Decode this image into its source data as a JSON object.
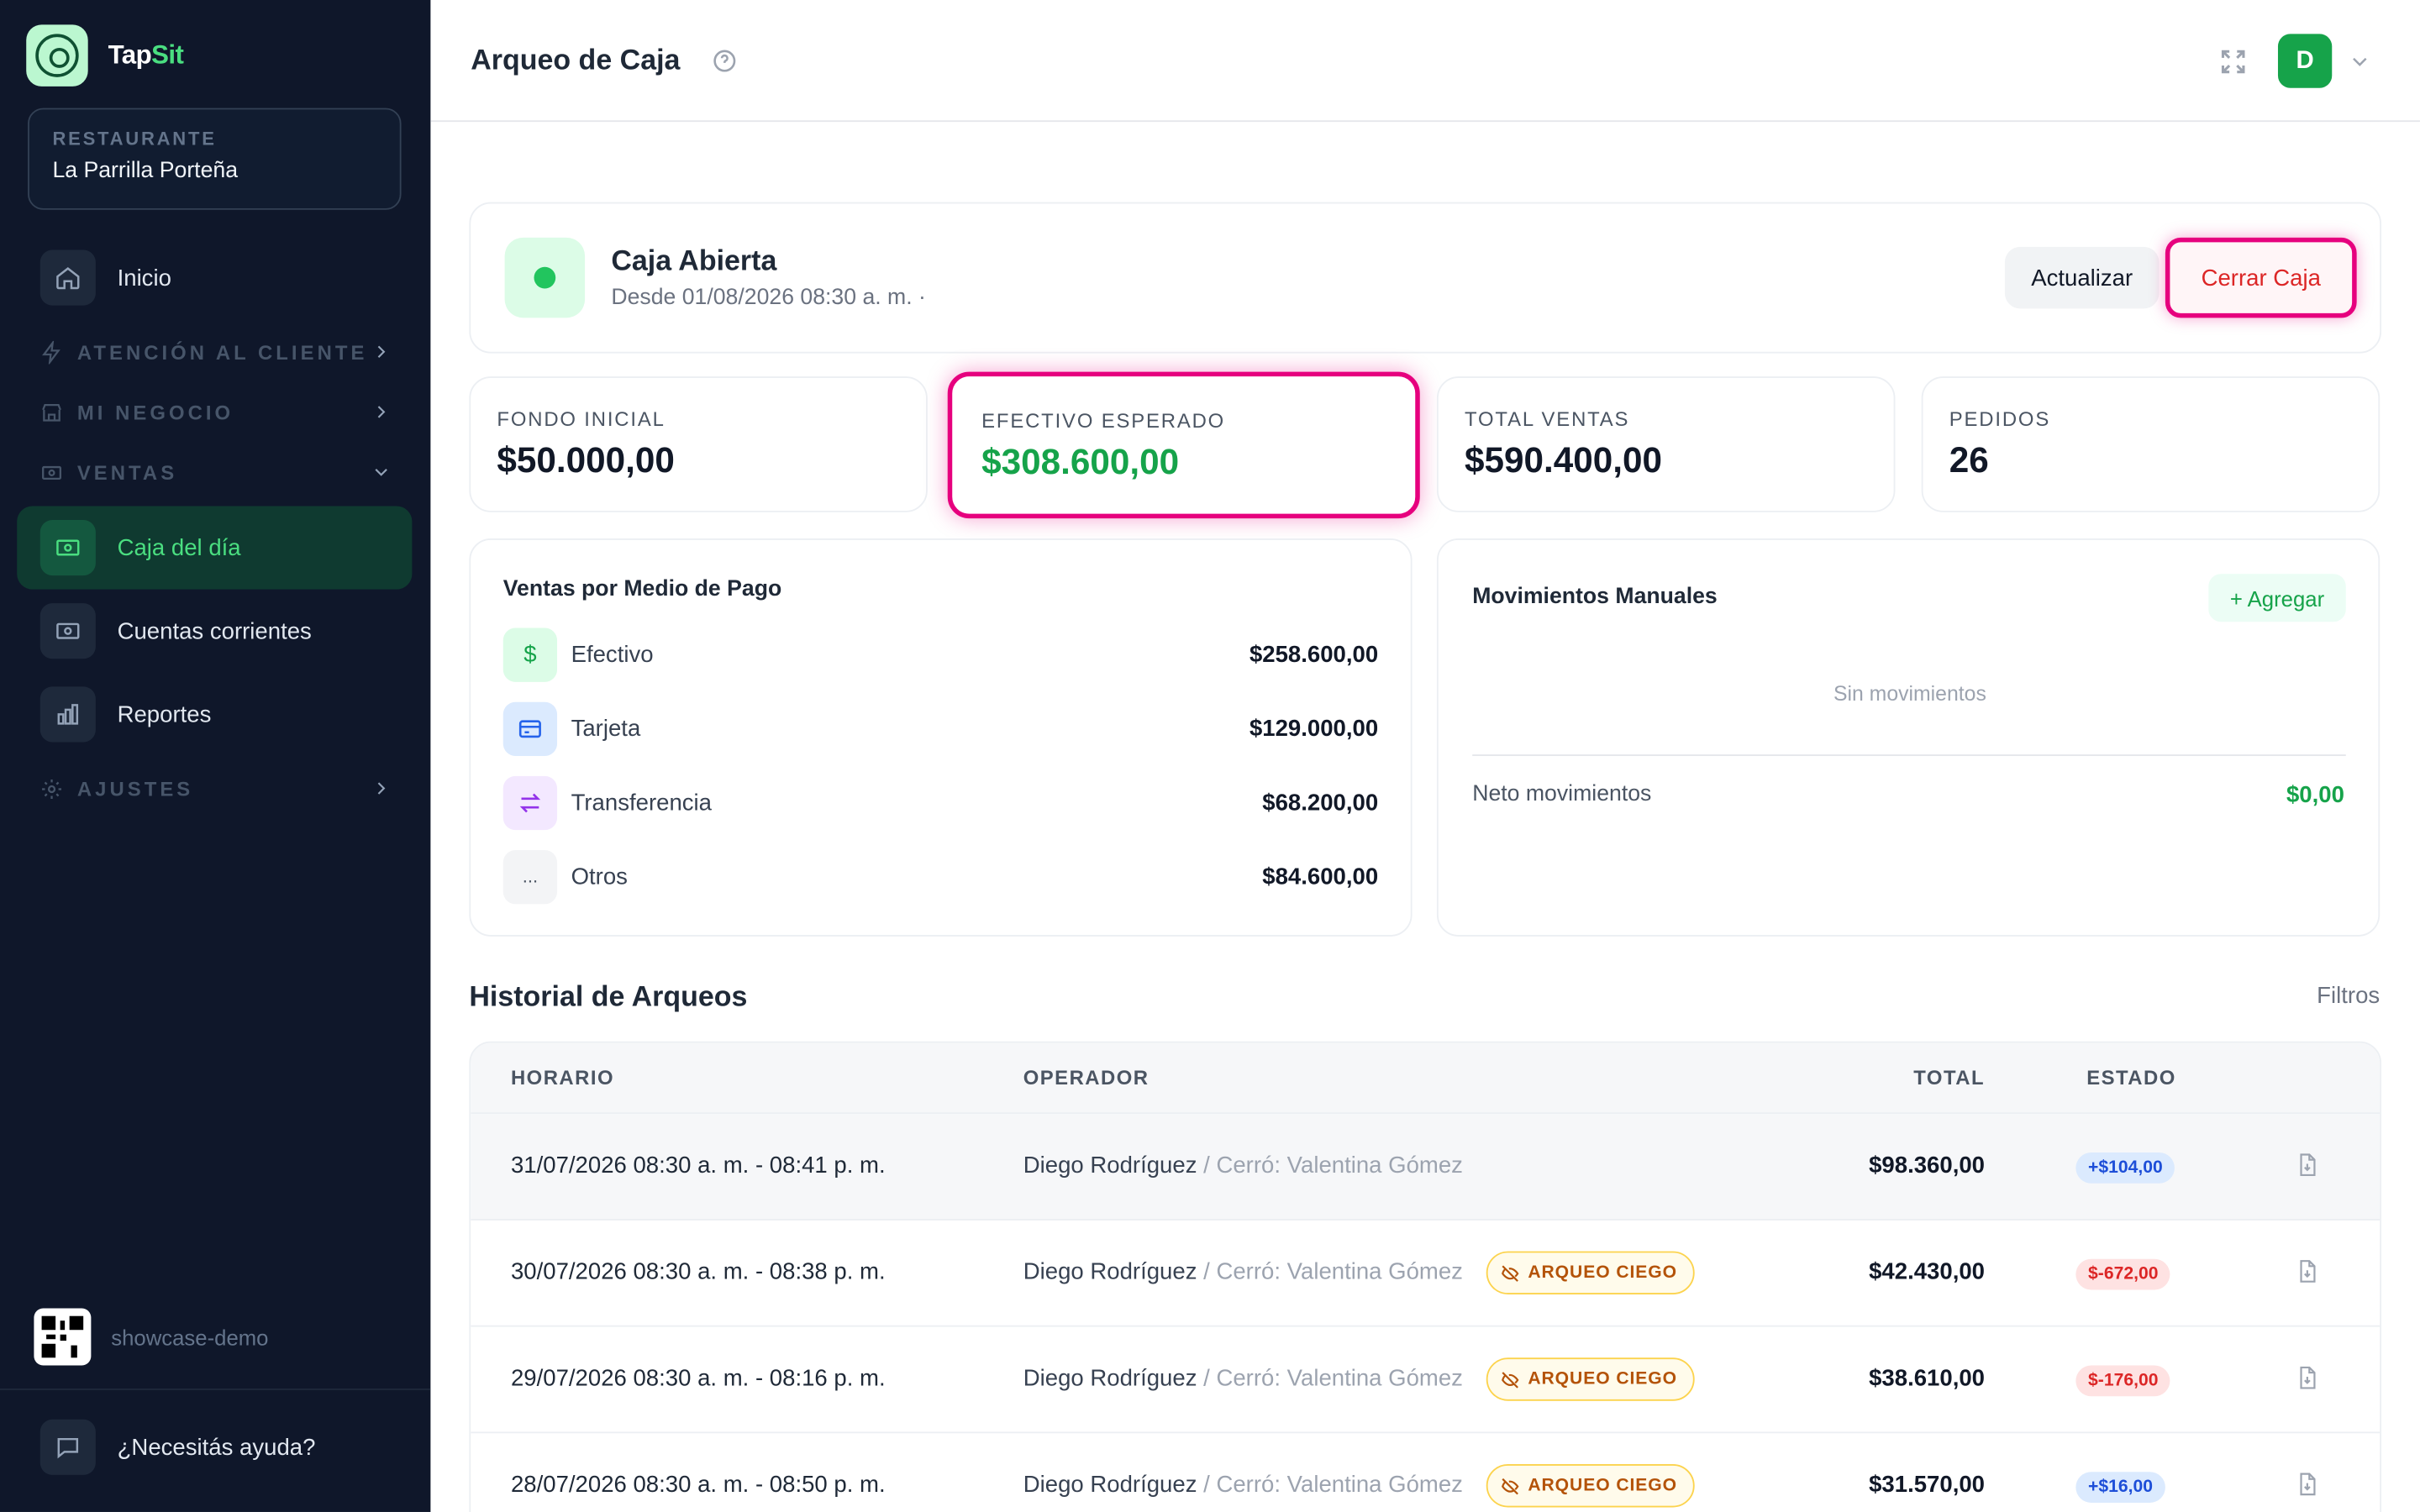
{
  "brand": {
    "name_main": "Tap",
    "name_accent": "Sit"
  },
  "restaurant": {
    "label": "RESTAURANTE",
    "name": "La Parrilla Porteña"
  },
  "nav": {
    "inicio": "Inicio",
    "atencion": "ATENCIÓN AL CLIENTE",
    "negocio": "MI NEGOCIO",
    "ventas": "VENTAS",
    "caja": "Caja del día",
    "cuentas": "Cuentas corrientes",
    "reportes": "Reportes",
    "ajustes": "AJUSTES"
  },
  "footer": {
    "workspace": "showcase-demo",
    "help": "¿Necesitás ayuda?"
  },
  "header": {
    "title": "Arqueo de Caja",
    "avatar_initial": "D"
  },
  "status": {
    "title": "Caja Abierta",
    "subtitle": "Desde 01/08/2026 08:30 a. m. ·",
    "refresh_label": "Actualizar",
    "close_label": "Cerrar Caja"
  },
  "stats": [
    {
      "label": "FONDO INICIAL",
      "value": "$50.000,00"
    },
    {
      "label": "EFECTIVO ESPERADO",
      "value": "$308.600,00"
    },
    {
      "label": "TOTAL VENTAS",
      "value": "$590.400,00"
    },
    {
      "label": "PEDIDOS",
      "value": "26"
    }
  ],
  "payments": {
    "title": "Ventas por Medio de Pago",
    "rows": [
      {
        "name": "Efectivo",
        "amount": "$258.600,00",
        "icon": "dollar-icon",
        "glyph": "$"
      },
      {
        "name": "Tarjeta",
        "amount": "$129.000,00",
        "icon": "credit-card-icon",
        "glyph": ""
      },
      {
        "name": "Transferencia",
        "amount": "$68.200,00",
        "icon": "transfer-arrows-icon",
        "glyph": ""
      },
      {
        "name": "Otros",
        "amount": "$84.600,00",
        "icon": "ellipsis-icon",
        "glyph": "..."
      }
    ]
  },
  "movements": {
    "title": "Movimientos Manuales",
    "add_label": "+ Agregar",
    "empty": "Sin movimientos",
    "net_label": "Neto movimientos",
    "net_value": "$0,00"
  },
  "history": {
    "title": "Historial de Arqueos",
    "filters_label": "Filtros",
    "columns": {
      "time": "HORARIO",
      "operator": "OPERADOR",
      "total": "TOTAL",
      "status": "ESTADO"
    },
    "blind_label": "ARQUEO CIEGO",
    "rows": [
      {
        "time": "31/07/2026 08:30 a. m. - 08:41 p. m.",
        "operator": "Diego Rodríguez",
        "closer": " / Cerró: Valentina Gómez",
        "blind": false,
        "total": "$98.360,00",
        "diff": "+$104,00",
        "positive": true
      },
      {
        "time": "30/07/2026 08:30 a. m. - 08:38 p. m.",
        "operator": "Diego Rodríguez",
        "closer": " / Cerró: Valentina Gómez",
        "blind": true,
        "total": "$42.430,00",
        "diff": "$-672,00",
        "positive": false
      },
      {
        "time": "29/07/2026 08:30 a. m. - 08:16 p. m.",
        "operator": "Diego Rodríguez",
        "closer": " / Cerró: Valentina Gómez",
        "blind": true,
        "total": "$38.610,00",
        "diff": "$-176,00",
        "positive": false
      },
      {
        "time": "28/07/2026 08:30 a. m. - 08:50 p. m.",
        "operator": "Diego Rodríguez",
        "closer": " / Cerró: Valentina Gómez",
        "blind": true,
        "total": "$31.570,00",
        "diff": "+$16,00",
        "positive": true
      }
    ]
  },
  "colors": {
    "sidebar_bg": "#0f172a",
    "accent_green": "#16a34a",
    "highlight_pink": "#e6007e",
    "danger_red": "#dc2626"
  }
}
